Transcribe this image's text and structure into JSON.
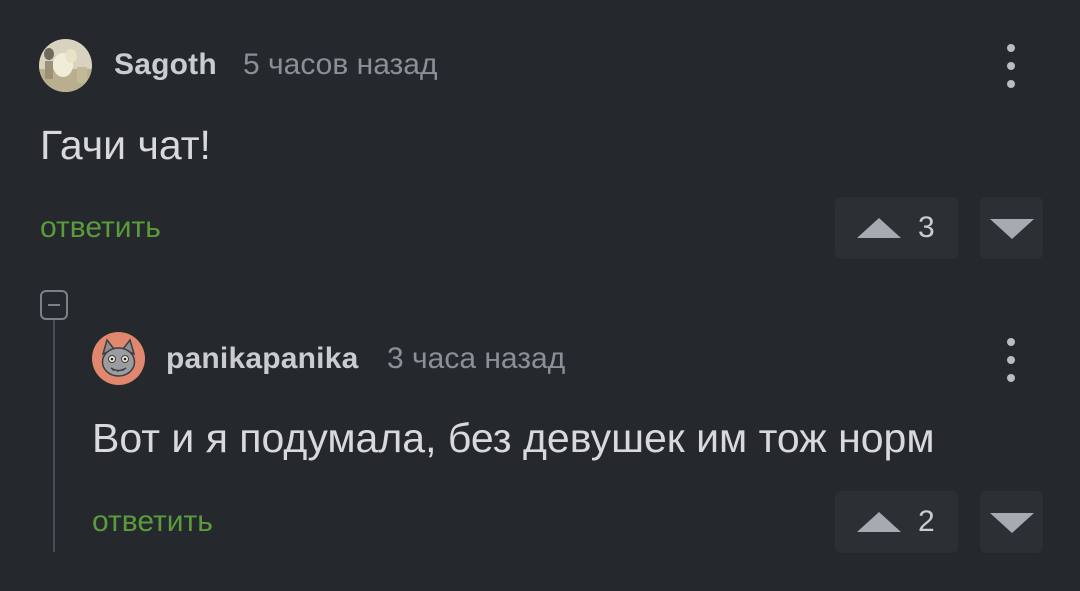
{
  "comments": [
    {
      "author": "Sagoth",
      "timestamp": "5 часов назад",
      "text": "Гачи чат!",
      "reply_label": "ответить",
      "rating": "3",
      "avatar_icon": "photo-avatar"
    },
    {
      "author": "panikapanika",
      "timestamp": "3 часа назад",
      "text": "Вот и я подумала, без девушек им тож норм",
      "reply_label": "ответить",
      "rating": "2",
      "avatar_icon": "cat-avatar"
    }
  ],
  "icons": {
    "menu": "more-vertical-icon",
    "upvote": "triangle-up-icon",
    "downvote": "triangle-down-icon",
    "collapse": "minus-square-icon"
  },
  "colors": {
    "background": "#25282c",
    "reply_link": "#5a9c3b",
    "vote_box": "#2c3035"
  }
}
